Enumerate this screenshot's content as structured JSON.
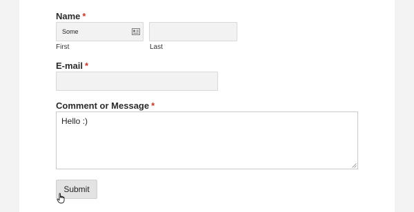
{
  "form": {
    "name": {
      "label": "Name",
      "required_mark": "*",
      "first": {
        "value": "Some",
        "sublabel": "First",
        "icon": "contact-card-icon"
      },
      "last": {
        "value": "",
        "sublabel": "Last"
      }
    },
    "email": {
      "label": "E-mail",
      "required_mark": "*",
      "value": ""
    },
    "comment": {
      "label": "Comment or Message",
      "required_mark": "*",
      "value": "Hello :)"
    },
    "submit_label": "Submit"
  },
  "colors": {
    "required": "#c0392b",
    "page_background": "#f3f3f3",
    "field_background": "#f2f2f2",
    "button_background": "#e3e3e3"
  },
  "cursor": "hand-pointer-icon"
}
